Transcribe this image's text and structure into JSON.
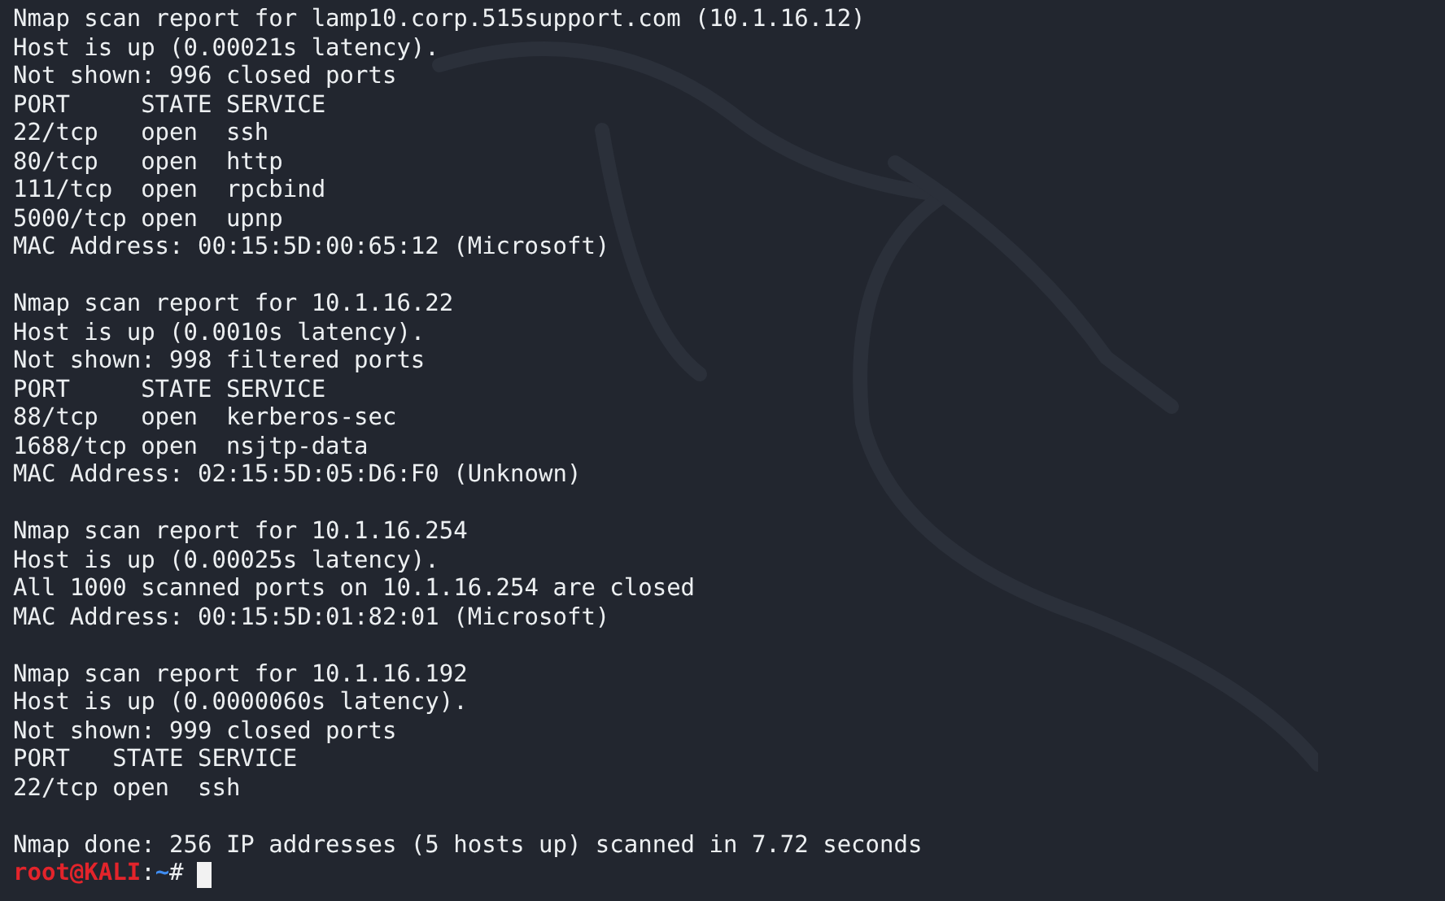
{
  "terminal": {
    "reports": [
      {
        "lines": [
          "Nmap scan report for lamp10.corp.515support.com (10.1.16.12)",
          "Host is up (0.00021s latency).",
          "Not shown: 996 closed ports",
          "PORT     STATE SERVICE",
          "22/tcp   open  ssh",
          "80/tcp   open  http",
          "111/tcp  open  rpcbind",
          "5000/tcp open  upnp",
          "MAC Address: 00:15:5D:00:65:12 (Microsoft)"
        ]
      },
      {
        "lines": [
          "Nmap scan report for 10.1.16.22",
          "Host is up (0.0010s latency).",
          "Not shown: 998 filtered ports",
          "PORT     STATE SERVICE",
          "88/tcp   open  kerberos-sec",
          "1688/tcp open  nsjtp-data",
          "MAC Address: 02:15:5D:05:D6:F0 (Unknown)"
        ]
      },
      {
        "lines": [
          "Nmap scan report for 10.1.16.254",
          "Host is up (0.00025s latency).",
          "All 1000 scanned ports on 10.1.16.254 are closed",
          "MAC Address: 00:15:5D:01:82:01 (Microsoft)"
        ]
      },
      {
        "lines": [
          "Nmap scan report for 10.1.16.192",
          "Host is up (0.0000060s latency).",
          "Not shown: 999 closed ports",
          "PORT   STATE SERVICE",
          "22/tcp open  ssh"
        ]
      }
    ],
    "summary": "Nmap done: 256 IP addresses (5 hosts up) scanned in 7.72 seconds",
    "prompt": {
      "user_host": "root@KALI",
      "separator": ":",
      "path": "~",
      "symbol": "#"
    }
  }
}
